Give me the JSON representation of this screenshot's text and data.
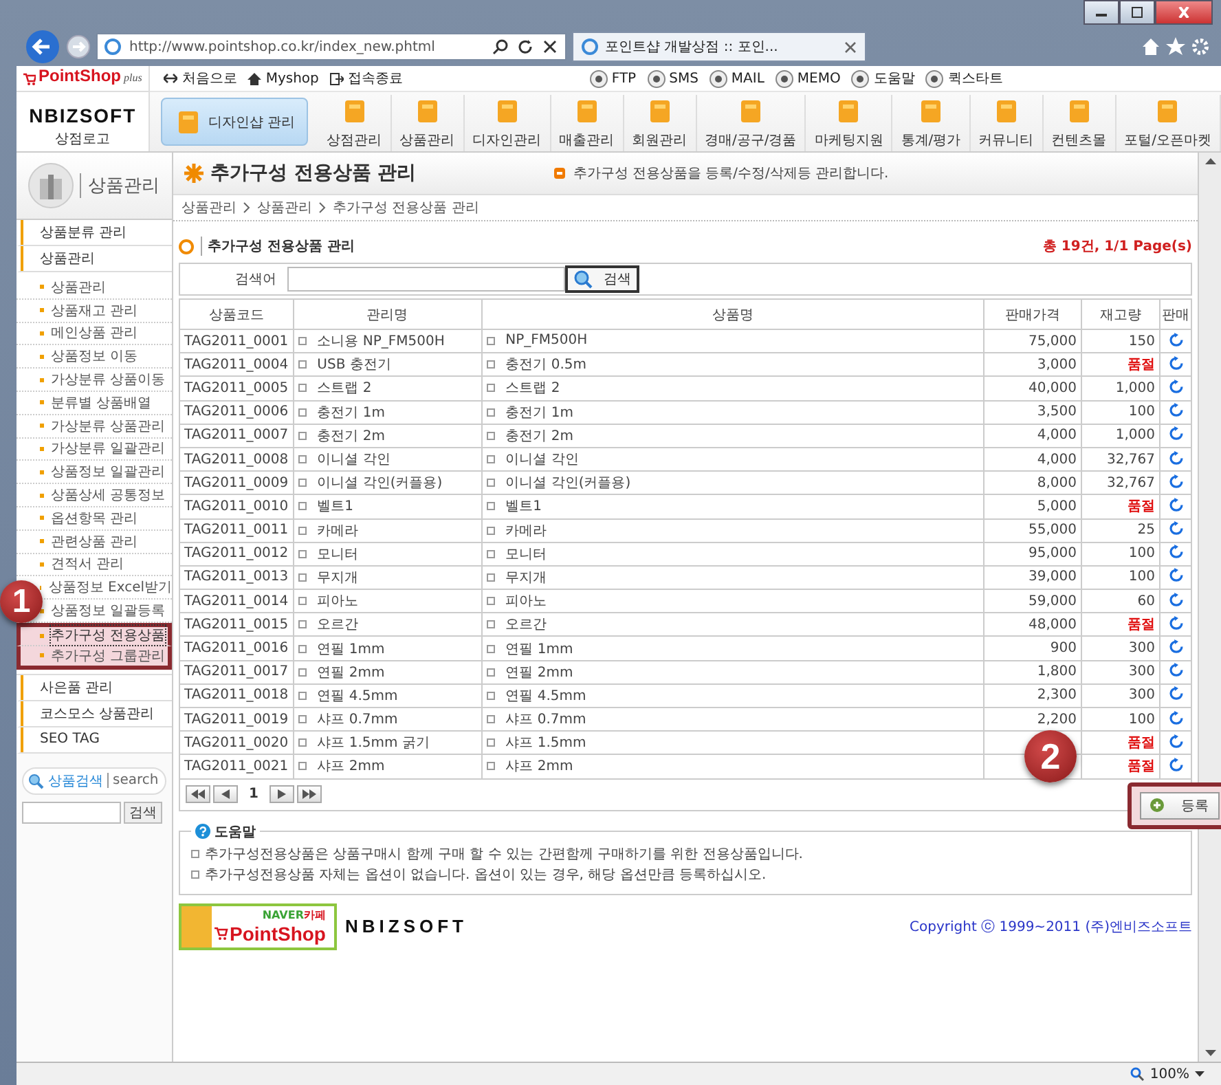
{
  "browser": {
    "url": "http://www.pointshop.co.kr/index_new.phtml",
    "tab": "포인트샵 개발상점 :: 포인...",
    "zoom": "100%"
  },
  "header": {
    "brand": "PointShop",
    "brand_suffix": "plus",
    "company": "NBIZSOFT",
    "logo_caption": "상점로고"
  },
  "top_links": [
    {
      "label": "처음으로",
      "kind": "arrows"
    },
    {
      "label": "Myshop",
      "kind": "home"
    },
    {
      "label": "접속종료",
      "kind": "exit"
    }
  ],
  "tools": [
    {
      "label": "FTP"
    },
    {
      "label": "SMS"
    },
    {
      "label": "MAIL"
    },
    {
      "label": "MEMO"
    },
    {
      "label": "도움말"
    },
    {
      "label": "퀵스타트"
    }
  ],
  "menu": [
    {
      "label": "디자인샵 관리",
      "selected": true
    },
    {
      "label": "상점관리",
      "selected": false
    },
    {
      "label": "상품관리",
      "selected": false
    },
    {
      "label": "디자인관리",
      "selected": false
    },
    {
      "label": "매출관리",
      "selected": false
    },
    {
      "label": "회원관리",
      "selected": false
    },
    {
      "label": "경매/공구/경품",
      "selected": false
    },
    {
      "label": "마케팅지원",
      "selected": false
    },
    {
      "label": "통계/평가",
      "selected": false
    },
    {
      "label": "커뮤니티",
      "selected": false
    },
    {
      "label": "컨텐츠몰",
      "selected": false
    },
    {
      "label": "포털/오픈마켓",
      "selected": false
    }
  ],
  "sidebar": {
    "title": "상품관리",
    "groups": [
      {
        "label": "상품분류 관리"
      },
      {
        "label": "상품관리",
        "items": [
          {
            "label": "상품관리",
            "selected": false,
            "highlighted": false
          },
          {
            "label": "상품재고 관리",
            "selected": false,
            "highlighted": false
          },
          {
            "label": "메인상품 관리",
            "selected": false,
            "highlighted": false
          },
          {
            "label": "상품정보 이동",
            "selected": false,
            "highlighted": false
          },
          {
            "label": "가상분류 상품이동",
            "selected": false,
            "highlighted": false
          },
          {
            "label": "분류별 상품배열",
            "selected": false,
            "highlighted": false
          },
          {
            "label": "가상분류 상품관리",
            "selected": false,
            "highlighted": false
          },
          {
            "label": "가상분류 일괄관리",
            "selected": false,
            "highlighted": false
          },
          {
            "label": "상품정보 일괄관리",
            "selected": false,
            "highlighted": false
          },
          {
            "label": "상품상세 공통정보",
            "selected": false,
            "highlighted": false
          },
          {
            "label": "옵션항목 관리",
            "selected": false,
            "highlighted": false
          },
          {
            "label": "관련상품 관리",
            "selected": false,
            "highlighted": false
          },
          {
            "label": "견적서 관리",
            "selected": false,
            "highlighted": false
          },
          {
            "label": "상품정보 Excel받기",
            "selected": false,
            "highlighted": false
          },
          {
            "label": "상품정보 일괄등록",
            "selected": false,
            "highlighted": false
          },
          {
            "label": "추가구성 전용상품",
            "selected": true,
            "highlighted": true
          },
          {
            "label": "추가구성 그룹관리",
            "selected": false,
            "highlighted": true
          }
        ]
      },
      {
        "label": "사은품 관리"
      },
      {
        "label": "코스모스 상품관리"
      },
      {
        "label": "SEO TAG"
      }
    ],
    "search": {
      "label": "상품검색",
      "hint": "search",
      "button": "검색"
    }
  },
  "content": {
    "title": "추가구성 전용상품 관리",
    "description": "추가구성 전용상품을 등록/수정/삭제등 관리합니다.",
    "breadcrumb": [
      "상품관리",
      "상품관리",
      "추가구성 전용상품 관리"
    ],
    "section_title": "추가구성 전용상품 관리",
    "summary": "총 19건, 1/1 Page(s)",
    "search_label": "검색어",
    "search_button": "검색"
  },
  "table": {
    "columns": [
      "상품코드",
      "관리명",
      "상품명",
      "판매가격",
      "재고량",
      "판매"
    ],
    "rows": [
      {
        "code": "TAG2011_0001",
        "manage_name": "소니용 NP_FM500H",
        "product_name": "NP_FM500H",
        "price": "75,000",
        "stock": "150",
        "sold_out": false
      },
      {
        "code": "TAG2011_0004",
        "manage_name": "USB 충전기",
        "product_name": "충전기 0.5m",
        "price": "3,000",
        "stock": "품절",
        "sold_out": true
      },
      {
        "code": "TAG2011_0005",
        "manage_name": "스트랩 2",
        "product_name": "스트랩 2",
        "price": "40,000",
        "stock": "1,000",
        "sold_out": false
      },
      {
        "code": "TAG2011_0006",
        "manage_name": "충전기 1m",
        "product_name": "충전기 1m",
        "price": "3,500",
        "stock": "100",
        "sold_out": false
      },
      {
        "code": "TAG2011_0007",
        "manage_name": "충전기 2m",
        "product_name": "충전기 2m",
        "price": "4,000",
        "stock": "1,000",
        "sold_out": false
      },
      {
        "code": "TAG2011_0008",
        "manage_name": "이니셜 각인",
        "product_name": "이니셜 각인",
        "price": "4,000",
        "stock": "32,767",
        "sold_out": false
      },
      {
        "code": "TAG2011_0009",
        "manage_name": "이니셜 각인(커플용)",
        "product_name": "이니셜 각인(커플용)",
        "price": "8,000",
        "stock": "32,767",
        "sold_out": false
      },
      {
        "code": "TAG2011_0010",
        "manage_name": "벨트1",
        "product_name": "벨트1",
        "price": "5,000",
        "stock": "품절",
        "sold_out": true
      },
      {
        "code": "TAG2011_0011",
        "manage_name": "카메라",
        "product_name": "카메라",
        "price": "55,000",
        "stock": "25",
        "sold_out": false
      },
      {
        "code": "TAG2011_0012",
        "manage_name": "모니터",
        "product_name": "모니터",
        "price": "95,000",
        "stock": "100",
        "sold_out": false
      },
      {
        "code": "TAG2011_0013",
        "manage_name": "무지개",
        "product_name": "무지개",
        "price": "39,000",
        "stock": "100",
        "sold_out": false
      },
      {
        "code": "TAG2011_0014",
        "manage_name": "피아노",
        "product_name": "피아노",
        "price": "59,000",
        "stock": "60",
        "sold_out": false
      },
      {
        "code": "TAG2011_0015",
        "manage_name": "오르간",
        "product_name": "오르간",
        "price": "48,000",
        "stock": "품절",
        "sold_out": true
      },
      {
        "code": "TAG2011_0016",
        "manage_name": "연필 1mm",
        "product_name": "연필 1mm",
        "price": "900",
        "stock": "300",
        "sold_out": false
      },
      {
        "code": "TAG2011_0017",
        "manage_name": "연필 2mm",
        "product_name": "연필 2mm",
        "price": "1,800",
        "stock": "300",
        "sold_out": false
      },
      {
        "code": "TAG2011_0018",
        "manage_name": "연필 4.5mm",
        "product_name": "연필 4.5mm",
        "price": "2,300",
        "stock": "300",
        "sold_out": false
      },
      {
        "code": "TAG2011_0019",
        "manage_name": "샤프 0.7mm",
        "product_name": "샤프 0.7mm",
        "price": "2,200",
        "stock": "100",
        "sold_out": false
      },
      {
        "code": "TAG2011_0020",
        "manage_name": "샤프 1.5mm 굵기",
        "product_name": "샤프 1.5mm",
        "stock": "품절",
        "sold_out": true
      },
      {
        "code": "TAG2011_0021",
        "manage_name": "샤프 2mm",
        "product_name": "샤프 2mm",
        "stock": "품절",
        "sold_out": true
      }
    ]
  },
  "pager": {
    "current": "1"
  },
  "register_button": {
    "label": "등록",
    "highlighted": true
  },
  "help": {
    "title": "도움말",
    "lines": [
      "추가구성전용상품은 상품구매시 함께 구매 할 수 있는 간편함께 구매하기를 위한 전용상품입니다.",
      "추가구성전용상품 자체는 옵션이 없습니다. 옵션이 있는 경우, 해당 옵션만큼 등록하십시오."
    ]
  },
  "footer": {
    "cafe_top": "NAVER",
    "cafe_word": "카페",
    "cafe_brand": "PointShop",
    "company": "NBIZSOFT",
    "copyright": "Copyright ⓒ 1999~2011 (주)엔비즈소프트"
  },
  "annotations": [
    {
      "label": "1"
    },
    {
      "label": "2"
    }
  ]
}
